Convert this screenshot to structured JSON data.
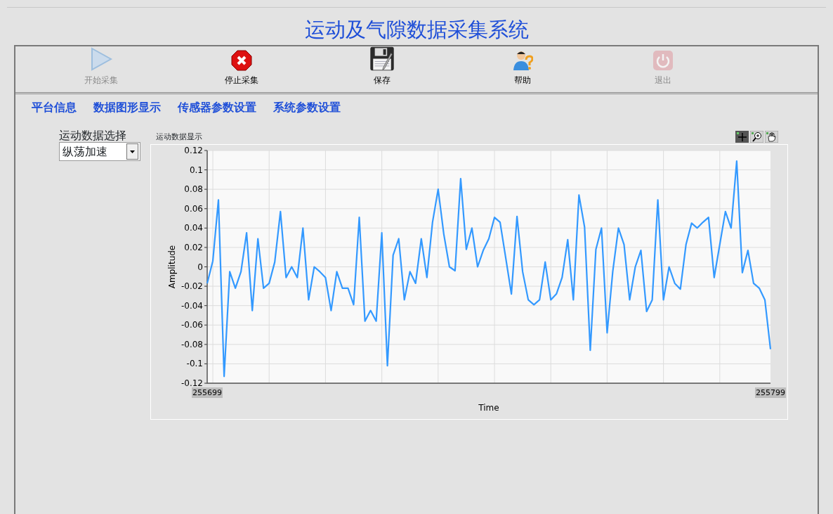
{
  "window": {
    "title": "运动及气隙数据采集系统"
  },
  "toolbar": [
    {
      "label": "开始采集",
      "kind": "start",
      "disabled": true
    },
    {
      "label": "停止采集",
      "kind": "stop",
      "disabled": false
    },
    {
      "label": "保存",
      "kind": "save",
      "disabled": false
    },
    {
      "label": "帮助",
      "kind": "help",
      "disabled": false
    },
    {
      "label": "退出",
      "kind": "exit",
      "disabled": true
    }
  ],
  "tabs": [
    {
      "label": "平台信息"
    },
    {
      "label": "数据图形显示"
    },
    {
      "label": "传感器参数设置"
    },
    {
      "label": "系统参数设置"
    }
  ],
  "selector": {
    "label": "运动数据选择",
    "value": "纵荡加速"
  },
  "graph": {
    "title": "运动数据显示",
    "chart_data": {
      "type": "line",
      "xlabel": "Time",
      "ylabel": "Amplitude",
      "grid": true,
      "x": [
        255699,
        255700,
        255701,
        255702,
        255703,
        255704,
        255705,
        255706,
        255707,
        255708,
        255709,
        255710,
        255711,
        255712,
        255713,
        255714,
        255715,
        255716,
        255717,
        255718,
        255719,
        255720,
        255721,
        255722,
        255723,
        255724,
        255725,
        255726,
        255727,
        255728,
        255729,
        255730,
        255731,
        255732,
        255733,
        255734,
        255735,
        255736,
        255737,
        255738,
        255739,
        255740,
        255741,
        255742,
        255743,
        255744,
        255745,
        255746,
        255747,
        255748,
        255749,
        255750,
        255751,
        255752,
        255753,
        255754,
        255755,
        255756,
        255757,
        255758,
        255759,
        255760,
        255761,
        255762,
        255763,
        255764,
        255765,
        255766,
        255767,
        255768,
        255769,
        255770,
        255771,
        255772,
        255773,
        255774,
        255775,
        255776,
        255777,
        255778,
        255779,
        255780,
        255781,
        255782,
        255783,
        255784,
        255785,
        255786,
        255787,
        255788,
        255789,
        255790,
        255791,
        255792,
        255793,
        255794,
        255795,
        255796,
        255797,
        255798,
        255799
      ],
      "xlim": [
        255699,
        255799
      ],
      "xticks": [
        255699,
        255799
      ],
      "ylim": [
        -0.12,
        0.12
      ],
      "yticks": [
        0.12,
        0.1,
        0.08,
        0.06,
        0.04,
        0.02,
        0,
        -0.02,
        -0.04,
        -0.06,
        -0.08,
        -0.1,
        -0.12
      ],
      "series": [
        {
          "color": "#3399ff",
          "values": [
            -0.017,
            0.006,
            0.069,
            -0.113,
            -0.005,
            -0.022,
            -0.005,
            0.035,
            -0.045,
            0.029,
            -0.022,
            -0.017,
            0.005,
            0.057,
            -0.011,
            0,
            -0.011,
            0.04,
            -0.034,
            0,
            -0.005,
            -0.011,
            -0.045,
            -0.005,
            -0.022,
            -0.022,
            -0.039,
            0.051,
            -0.056,
            -0.045,
            -0.056,
            0.035,
            -0.102,
            0.012,
            0.029,
            -0.034,
            -0.005,
            -0.017,
            0.029,
            -0.011,
            0.046,
            0.08,
            0.034,
            0,
            -0.004,
            0.091,
            0.018,
            0.04,
            0,
            0.017,
            0.029,
            0.051,
            0.046,
            0.009,
            -0.028,
            0.052,
            -0.005,
            -0.034,
            -0.039,
            -0.034,
            0.005,
            -0.034,
            -0.028,
            -0.011,
            0.028,
            -0.034,
            0.074,
            0.041,
            -0.086,
            0.018,
            0.04,
            -0.068,
            -0.005,
            0.04,
            0.023,
            -0.034,
            0,
            0.017,
            -0.046,
            -0.034,
            0.069,
            -0.034,
            0,
            -0.017,
            -0.023,
            0.023,
            0.045,
            0.04,
            0.046,
            0.051,
            -0.011,
            0.023,
            0.057,
            0.04,
            0.109,
            -0.006,
            0.017,
            -0.017,
            -0.022,
            -0.034,
            -0.085
          ]
        }
      ]
    }
  }
}
